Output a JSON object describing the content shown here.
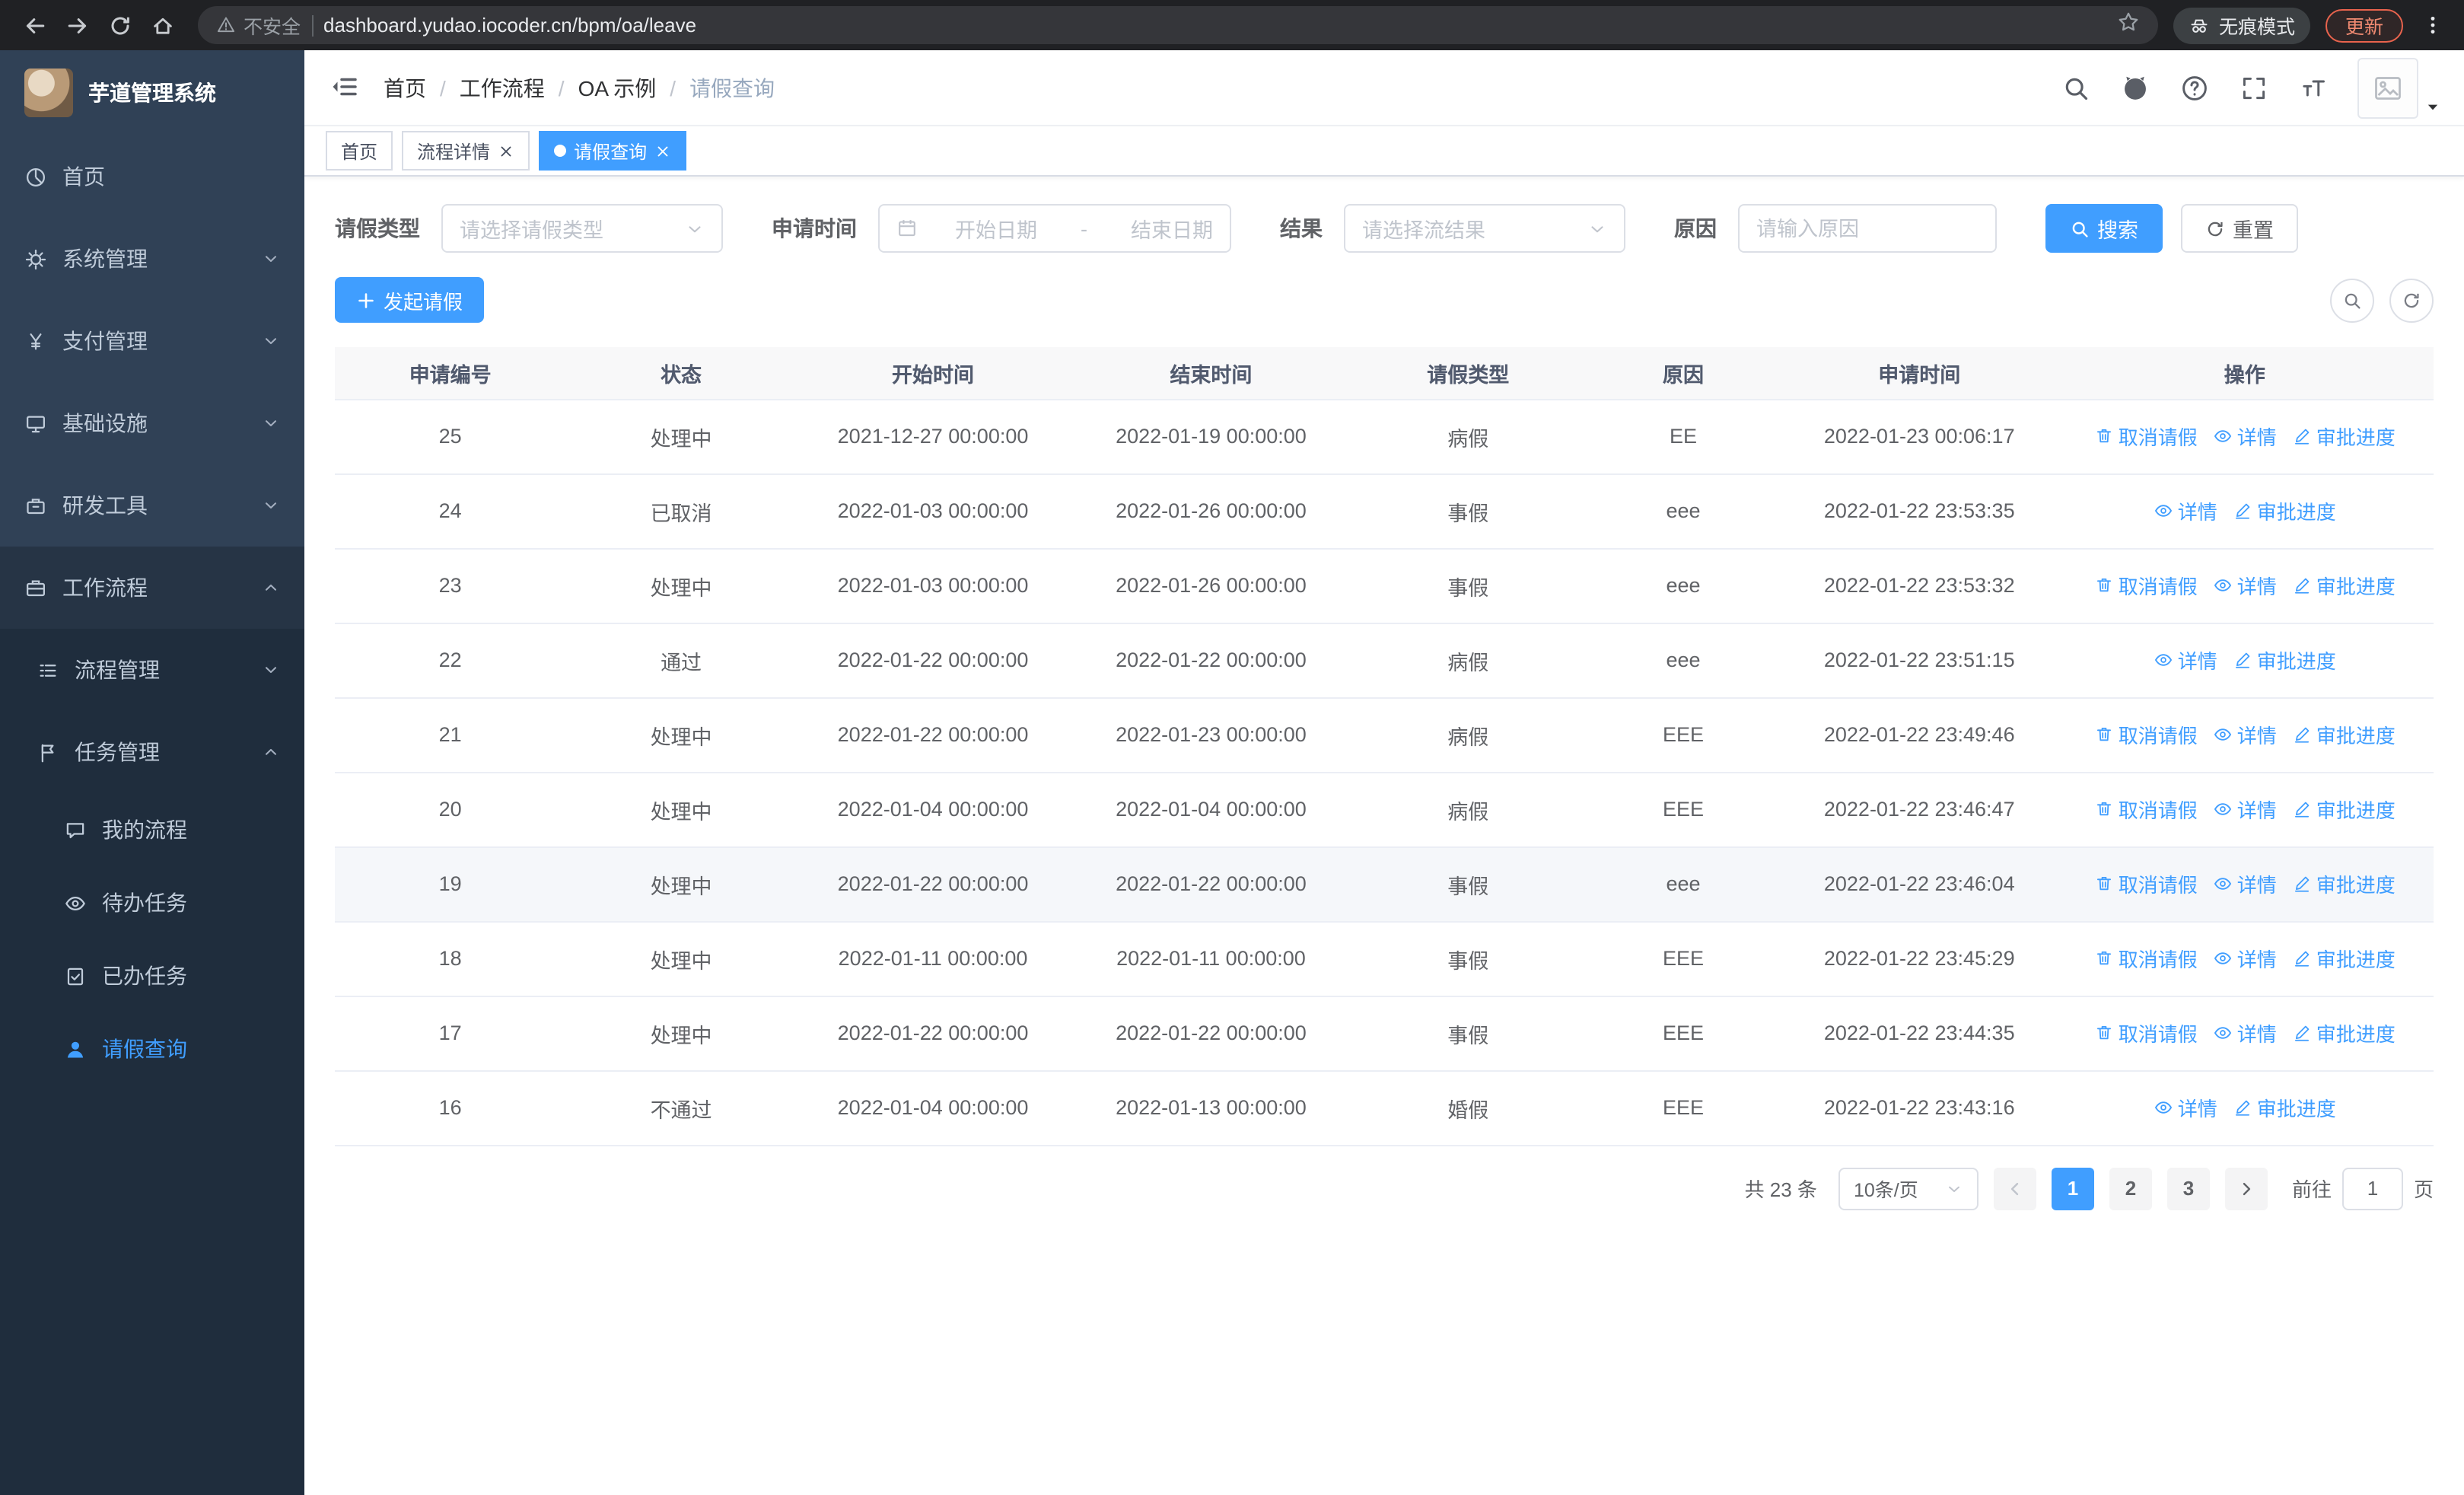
{
  "colors": {
    "primary": "#409eff",
    "sidebar_bg": "#304156",
    "submenu_bg": "#1f2d3d",
    "table_header_bg": "#f8f8f9"
  },
  "browser": {
    "security_chip": "不安全",
    "url": "dashboard.yudao.iocoder.cn/bpm/oa/leave",
    "incognito_label": "无痕模式",
    "update_label": "更新"
  },
  "sidebar": {
    "logo_title": "芋道管理系统",
    "menu": [
      {
        "label": "首页"
      },
      {
        "label": "系统管理"
      },
      {
        "label": "支付管理"
      },
      {
        "label": "基础设施"
      },
      {
        "label": "研发工具"
      },
      {
        "label": "工作流程"
      }
    ],
    "submenu": [
      {
        "label": "流程管理"
      },
      {
        "label": "任务管理"
      }
    ],
    "leaf_menu": [
      {
        "label": "我的流程"
      },
      {
        "label": "待办任务"
      },
      {
        "label": "已办任务"
      },
      {
        "label": "请假查询"
      }
    ]
  },
  "header": {
    "breadcrumbs": [
      "首页",
      "工作流程",
      "OA 示例",
      "请假查询"
    ],
    "separator": "/"
  },
  "tabs": [
    {
      "label": "首页",
      "closable": false,
      "active": false
    },
    {
      "label": "流程详情",
      "closable": true,
      "active": false
    },
    {
      "label": "请假查询",
      "closable": true,
      "active": true
    }
  ],
  "filters": {
    "leave_type_label": "请假类型",
    "leave_type_placeholder": "请选择请假类型",
    "apply_time_label": "申请时间",
    "start_date_placeholder": "开始日期",
    "date_separator": "-",
    "end_date_placeholder": "结束日期",
    "result_label": "结果",
    "result_placeholder": "请选择流结果",
    "reason_label": "原因",
    "reason_placeholder": "请输入原因",
    "search_button": "搜索",
    "reset_button": "重置"
  },
  "toolbar": {
    "create_button": "发起请假"
  },
  "table": {
    "columns": [
      "申请编号",
      "状态",
      "开始时间",
      "结束时间",
      "请假类型",
      "原因",
      "申请时间",
      "操作"
    ],
    "action_labels": {
      "cancel": "取消请假",
      "detail": "详情",
      "progress": "审批进度"
    },
    "rows": [
      {
        "id": "25",
        "status": "处理中",
        "start": "2021-12-27 00:00:00",
        "end": "2022-01-19 00:00:00",
        "type": "病假",
        "reason": "EE",
        "apply_time": "2022-01-23 00:06:17",
        "can_cancel": true,
        "highlight": false
      },
      {
        "id": "24",
        "status": "已取消",
        "start": "2022-01-03 00:00:00",
        "end": "2022-01-26 00:00:00",
        "type": "事假",
        "reason": "eee",
        "apply_time": "2022-01-22 23:53:35",
        "can_cancel": false,
        "highlight": false
      },
      {
        "id": "23",
        "status": "处理中",
        "start": "2022-01-03 00:00:00",
        "end": "2022-01-26 00:00:00",
        "type": "事假",
        "reason": "eee",
        "apply_time": "2022-01-22 23:53:32",
        "can_cancel": true,
        "highlight": false
      },
      {
        "id": "22",
        "status": "通过",
        "start": "2022-01-22 00:00:00",
        "end": "2022-01-22 00:00:00",
        "type": "病假",
        "reason": "eee",
        "apply_time": "2022-01-22 23:51:15",
        "can_cancel": false,
        "highlight": false
      },
      {
        "id": "21",
        "status": "处理中",
        "start": "2022-01-22 00:00:00",
        "end": "2022-01-23 00:00:00",
        "type": "病假",
        "reason": "EEE",
        "apply_time": "2022-01-22 23:49:46",
        "can_cancel": true,
        "highlight": false
      },
      {
        "id": "20",
        "status": "处理中",
        "start": "2022-01-04 00:00:00",
        "end": "2022-01-04 00:00:00",
        "type": "病假",
        "reason": "EEE",
        "apply_time": "2022-01-22 23:46:47",
        "can_cancel": true,
        "highlight": false
      },
      {
        "id": "19",
        "status": "处理中",
        "start": "2022-01-22 00:00:00",
        "end": "2022-01-22 00:00:00",
        "type": "事假",
        "reason": "eee",
        "apply_time": "2022-01-22 23:46:04",
        "can_cancel": true,
        "highlight": true
      },
      {
        "id": "18",
        "status": "处理中",
        "start": "2022-01-11 00:00:00",
        "end": "2022-01-11 00:00:00",
        "type": "事假",
        "reason": "EEE",
        "apply_time": "2022-01-22 23:45:29",
        "can_cancel": true,
        "highlight": false
      },
      {
        "id": "17",
        "status": "处理中",
        "start": "2022-01-22 00:00:00",
        "end": "2022-01-22 00:00:00",
        "type": "事假",
        "reason": "EEE",
        "apply_time": "2022-01-22 23:44:35",
        "can_cancel": true,
        "highlight": false
      },
      {
        "id": "16",
        "status": "不通过",
        "start": "2022-01-04 00:00:00",
        "end": "2022-01-13 00:00:00",
        "type": "婚假",
        "reason": "EEE",
        "apply_time": "2022-01-22 23:43:16",
        "can_cancel": false,
        "highlight": false
      }
    ]
  },
  "pagination": {
    "total_text": "共 23 条",
    "page_size": "10条/页",
    "pages": [
      "1",
      "2",
      "3"
    ],
    "active_page": "1",
    "goto_label": "前往",
    "goto_value": "1",
    "goto_suffix": "页"
  }
}
